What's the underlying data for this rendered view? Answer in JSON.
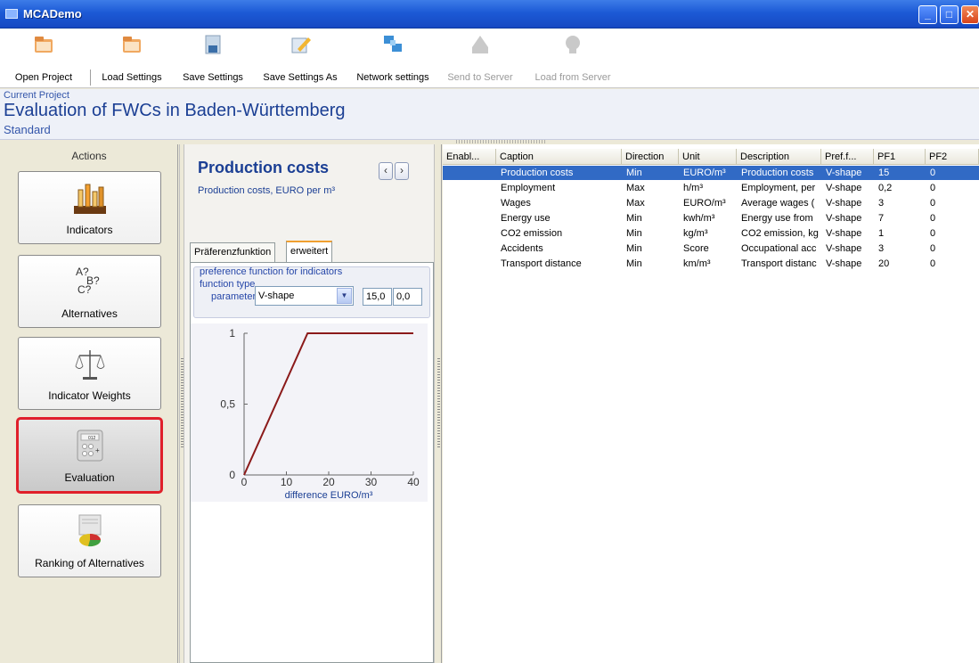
{
  "window": {
    "title": "MCADemo"
  },
  "toolbar": {
    "items": [
      {
        "label": "Open Project",
        "icon": "folder-icon",
        "enabled": true
      },
      {
        "label": "Load Settings",
        "icon": "folder-icon",
        "enabled": true
      },
      {
        "label": "Save Settings",
        "icon": "floppy-disk-icon",
        "enabled": true
      },
      {
        "label": "Save Settings As",
        "icon": "pencil-doc-icon",
        "enabled": true
      },
      {
        "label": "Network settings",
        "icon": "network-computers-icon",
        "enabled": true
      },
      {
        "label": "Send to Server",
        "icon": "server-upload-icon",
        "enabled": false
      },
      {
        "label": "Load from Server",
        "icon": "server-download-icon",
        "enabled": false
      }
    ]
  },
  "project": {
    "label": "Current Project",
    "name": "Evaluation of FWCs in Baden-Württemberg",
    "scenario": "Standard"
  },
  "actions": {
    "header": "Actions",
    "items": [
      {
        "label": "Indicators",
        "icon": "test-tubes-chart-icon"
      },
      {
        "label": "Alternatives",
        "icon": "question-letters-icon"
      },
      {
        "label": "Indicator Weights",
        "icon": "scales-icon"
      },
      {
        "label": "Evaluation",
        "icon": "calculator-icon",
        "selected": true
      },
      {
        "label": "Ranking of Alternatives",
        "icon": "pie-chart-doc-icon"
      }
    ]
  },
  "indicator": {
    "title": "Production costs",
    "description": "Production costs, EURO per m³",
    "prev_label": "‹",
    "next_label": "›"
  },
  "tabs": [
    {
      "label": "Präferenzfunktion",
      "active": false
    },
    {
      "label": "erweitert",
      "active": true
    }
  ],
  "preference": {
    "group_title": "preference function for indicators",
    "function_type_label": "function type",
    "parameters_label": "parameters",
    "function_type_value": "V-shape",
    "param1": "15,0",
    "param2": "0,0"
  },
  "chart_data": {
    "type": "line",
    "x": [
      0,
      15,
      40
    ],
    "y": [
      0,
      1,
      1
    ],
    "xlim": [
      0,
      40
    ],
    "ylim": [
      0,
      1
    ],
    "xticks": [
      0,
      10,
      20,
      30,
      40
    ],
    "xtick_labels": [
      "0",
      "10",
      "20",
      "30",
      "40"
    ],
    "yticks": [
      0,
      0.5,
      1
    ],
    "ytick_labels": [
      "0",
      "0,5",
      "1"
    ],
    "xlabel": "difference EURO/m³",
    "line_color": "#8b1a1a",
    "grid": false
  },
  "grid": {
    "columns": [
      "Enabl...",
      "Caption",
      "Direction",
      "Unit",
      "Description",
      "Pref.f...",
      "PF1",
      "PF2"
    ],
    "rows": [
      {
        "cells": [
          "",
          "Production costs",
          "Min",
          "EURO/m³",
          "Production costs",
          "V-shape",
          "15",
          "0"
        ],
        "selected": true
      },
      {
        "cells": [
          "",
          "Employment",
          "Max",
          "h/m³",
          "Employment, per",
          "V-shape",
          "0,2",
          "0"
        ]
      },
      {
        "cells": [
          "",
          "Wages",
          "Max",
          "EURO/m³",
          "Average wages (",
          "V-shape",
          "3",
          "0"
        ]
      },
      {
        "cells": [
          "",
          "Energy use",
          "Min",
          "kwh/m³",
          "Energy use from",
          "V-shape",
          "7",
          "0"
        ]
      },
      {
        "cells": [
          "",
          "CO2 emission",
          "Min",
          "kg/m³",
          "CO2 emission, kg",
          "V-shape",
          "1",
          "0"
        ]
      },
      {
        "cells": [
          "",
          "Accidents",
          "Min",
          "Score",
          "Occupational acc",
          "V-shape",
          "3",
          "0"
        ]
      },
      {
        "cells": [
          "",
          "Transport distance",
          "Min",
          "km/m³",
          "Transport distanc",
          "V-shape",
          "20",
          "0"
        ]
      }
    ]
  },
  "colors": {
    "selection": "#316ac5",
    "accent_blue": "#1b3f94",
    "selected_outline": "#e0202a"
  }
}
